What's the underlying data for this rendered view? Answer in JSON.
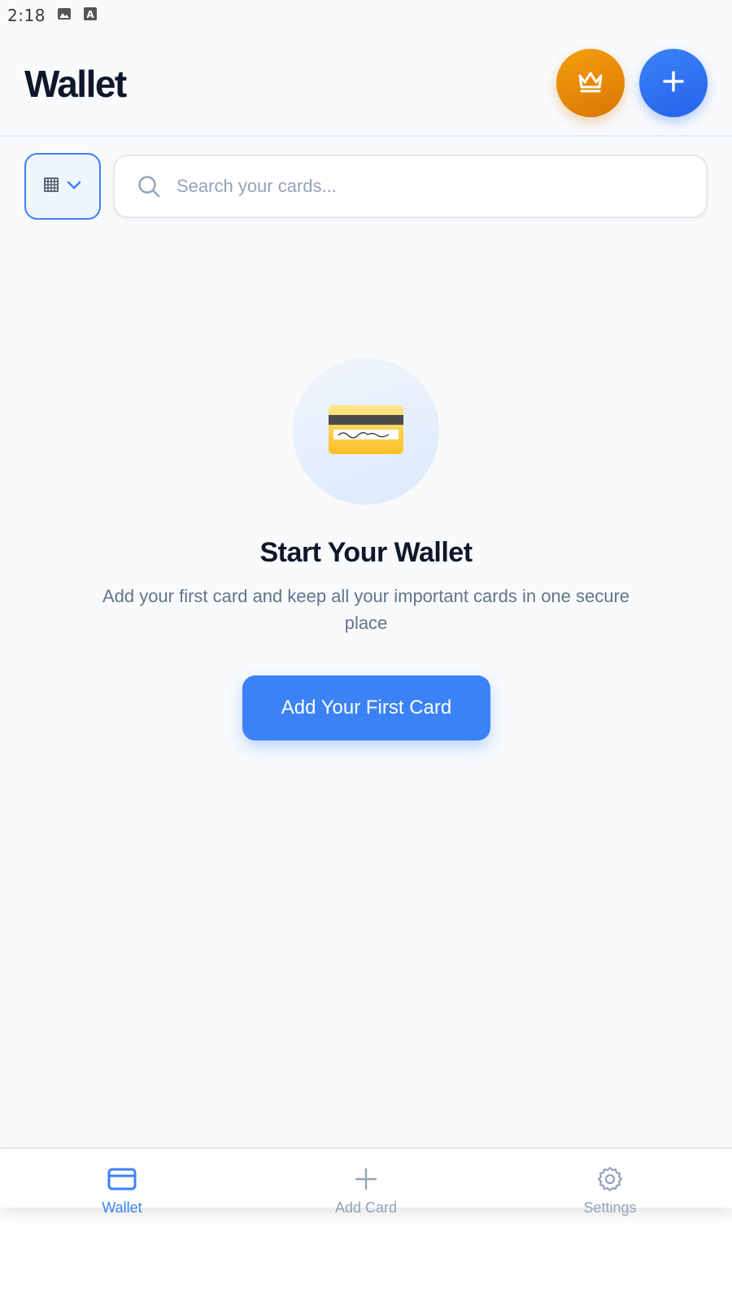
{
  "status_bar": {
    "time": "2:18",
    "icons": [
      "image-icon",
      "keyboard-a-icon"
    ]
  },
  "header": {
    "title": "Wallet",
    "premium_icon": "crown-icon",
    "add_icon": "plus-icon"
  },
  "toolbar": {
    "view_icon": "grid-icon",
    "dropdown_icon": "chevron-down-icon",
    "search": {
      "placeholder": "Search your cards...",
      "value": "",
      "icon": "search-icon"
    }
  },
  "empty_state": {
    "icon": "credit-card-icon",
    "title": "Start Your Wallet",
    "description": "Add your first card and keep all your important cards in one secure place",
    "button_label": "Add Your First Card"
  },
  "bottom_nav": {
    "items": [
      {
        "label": "Wallet",
        "icon": "card-icon",
        "active": true
      },
      {
        "label": "Add Card",
        "icon": "plus-icon",
        "active": false
      },
      {
        "label": "Settings",
        "icon": "gear-icon",
        "active": false
      }
    ]
  },
  "colors": {
    "accent": "#3b82f6",
    "premium": "#f59e0b",
    "background": "#f8fafc",
    "title_text": "#0f172a",
    "muted_text": "#64748b",
    "inactive_nav": "#94a3b8"
  }
}
